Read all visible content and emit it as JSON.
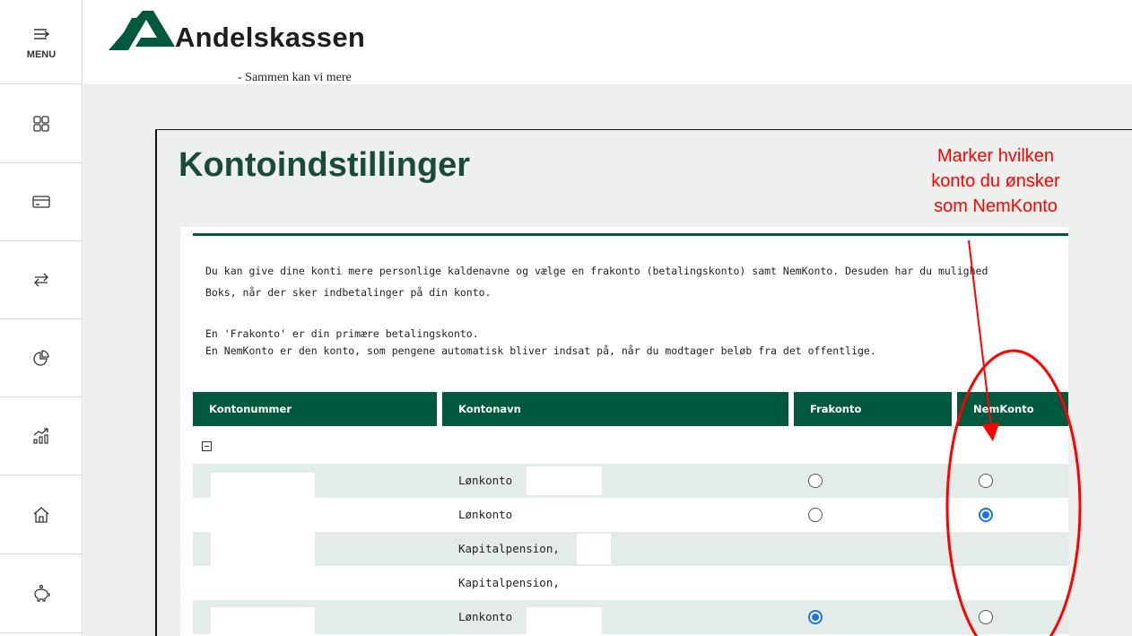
{
  "sidebar": {
    "menu_label": "MENU",
    "items": [
      {
        "icon": "dashboard-icon"
      },
      {
        "icon": "card-icon"
      },
      {
        "icon": "transfer-icon"
      },
      {
        "icon": "pie-chart-icon"
      },
      {
        "icon": "investment-icon"
      },
      {
        "icon": "home-icon"
      },
      {
        "icon": "piggy-bank-icon"
      }
    ]
  },
  "brand": {
    "name": "Andelskassen",
    "tagline": "- Sammen kan vi mere",
    "color": "#00593e"
  },
  "page": {
    "title": "Kontoindstillinger",
    "intro_line1": "Du kan give dine konti mere personlige kaldenavne og vælge en frakonto (betalingskonto) samt NemKonto. Desuden har du mulighed",
    "intro_line2": "Boks, når der sker indbetalinger på din konto.",
    "info_line1": "En 'Frakonto' er din primære betalingskonto.",
    "info_line2": "En NemKonto er den konto, som pengene automatisk bliver indsat på, når du modtager beløb fra det offentlige."
  },
  "table": {
    "headers": [
      "Kontonummer",
      "Kontonavn",
      "Frakonto",
      "NemKonto"
    ],
    "rows": [
      {
        "name": "Lønkonto",
        "frakonto": false,
        "nemkonto": false,
        "has_radios": true
      },
      {
        "name": "Lønkonto",
        "frakonto": false,
        "nemkonto": true,
        "has_radios": true
      },
      {
        "name": "Kapitalpension,",
        "has_radios": false
      },
      {
        "name": "Kapitalpension,",
        "has_radios": false
      },
      {
        "name": "Lønkonto",
        "frakonto": true,
        "nemkonto": false,
        "has_radios": true
      }
    ]
  },
  "annotation": {
    "line1": "Marker hvilken",
    "line2": "konto du ønsker",
    "line3": "som NemKonto",
    "color": "#ff0000"
  }
}
